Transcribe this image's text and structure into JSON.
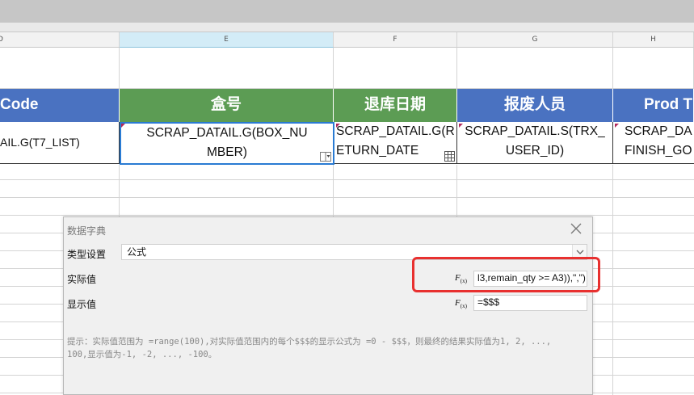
{
  "columns": {
    "d_letter": "D",
    "e_letter": "E",
    "f_letter": "F",
    "g_letter": "G",
    "h_letter": "H"
  },
  "header_row": {
    "d": "Code",
    "e": "盒号",
    "f": "退库日期",
    "g": "报废人员",
    "h": "Prod T"
  },
  "data_row": {
    "d": "AIL.G(T7_LIST)",
    "e": "SCRAP_DATAIL.G(BOX_NUMBER)",
    "f": "SCRAP_DATAIL.G(RETURN_DATE",
    "g": "SCRAP_DATAIL.S(TRX_USER_ID)",
    "h": "SCRAP_DAFINISH_GO"
  },
  "dialog": {
    "title": "数据字典",
    "type_label": "类型设置",
    "type_value": "公式",
    "actual_label": "实际值",
    "actual_value": "l3,remain_qty >= A3)),\",\")",
    "display_label": "显示值",
    "display_value": "=$$$",
    "fx_label": "F",
    "fx_sub": "(x)",
    "hint": "提示：实际值范围为 =range(100),对实际值范围内的每个$$$的显示公式为 =0 - $$$，则最终的结果实际值为1, 2, ..., 100,显示值为-1, -2, ..., -100。"
  },
  "colors": {
    "header_blue": "#4a72c1",
    "header_green": "#5c9c54",
    "selection_blue": "#2a7bd3",
    "highlight_red": "#e8302f"
  }
}
